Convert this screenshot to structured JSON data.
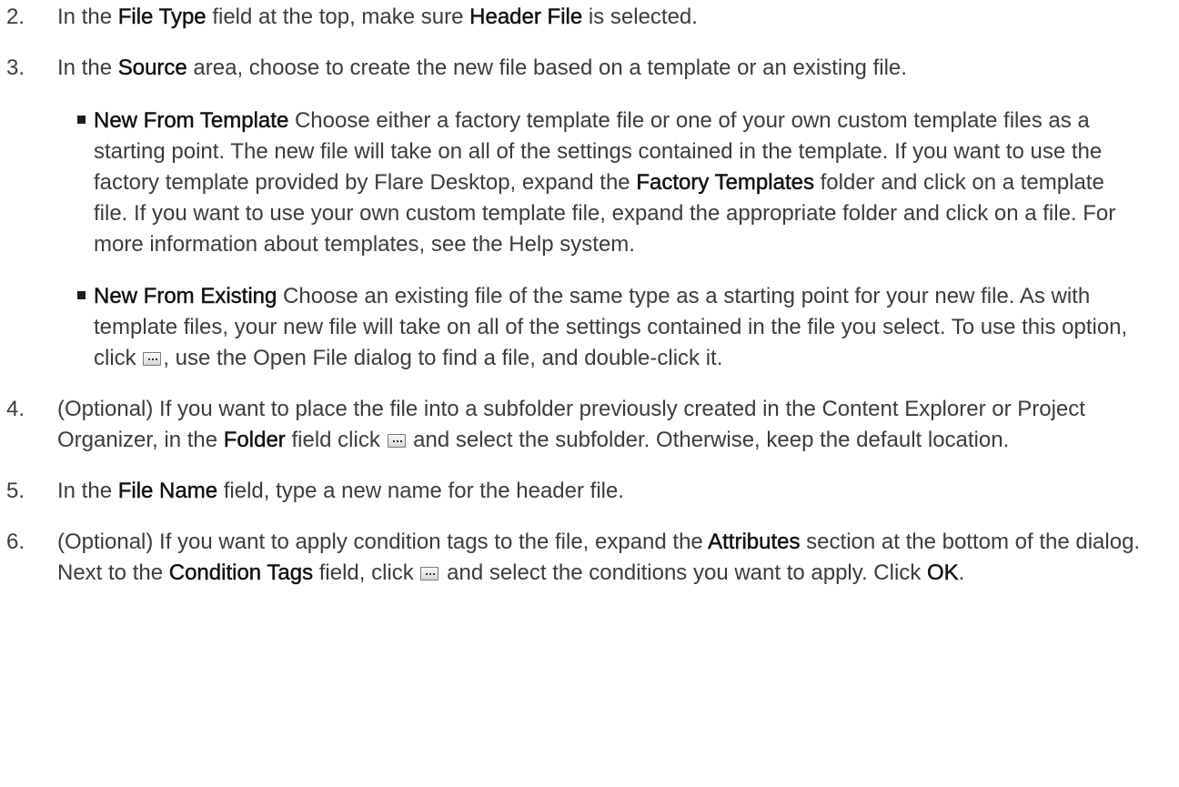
{
  "steps": [
    {
      "number": "2.",
      "parts": [
        "In the ",
        "File Type",
        " field at the top, make sure ",
        "Header File",
        " is selected."
      ]
    },
    {
      "number": "3.",
      "parts": [
        "In the ",
        "Source",
        " area, choose to create the new file based on a template or an existing file."
      ],
      "bullets": [
        {
          "parts": [
            "New From Template",
            " Choose either a factory template file or one of your own custom template files as a starting point. The new file will take on all of the settings contained in the template. If you want to use the factory template provided by Flare Desktop, expand the ",
            "Factory Templates",
            " folder and click on a template file. If you want to use your own custom template file, expand the appropriate folder and click on a file. For more information about templates, see the Help system."
          ]
        },
        {
          "parts": [
            "New From Existing",
            " Choose an existing file of the same type as a starting point for your new file. As with template files, your new file will take on all of the settings contained in the file you select. To use this option, click ",
            ", use the Open File dialog to find a file, and double-click it."
          ],
          "button_icon": "ellipsis-browse-button-icon"
        }
      ]
    },
    {
      "number": "4.",
      "parts": [
        "(Optional) If you want to place the file into a subfolder previously created in the Content Explorer or Project Organizer, in the ",
        "Folder",
        " field click ",
        " and select the subfolder. Otherwise, keep the default location."
      ],
      "button_icon": "ellipsis-browse-button-icon"
    },
    {
      "number": "5.",
      "parts": [
        "In the ",
        "File Name",
        " field, type a new name for the header file."
      ]
    },
    {
      "number": "6.",
      "parts": [
        "(Optional) If you want to apply condition tags to the file, expand the ",
        "Attributes",
        " section at the bottom of the dialog. Next to the ",
        "Condition Tags",
        " field, click ",
        " and select the conditions you want to apply. Click ",
        "OK",
        "."
      ],
      "button_icon": "ellipsis-browse-button-icon"
    }
  ]
}
